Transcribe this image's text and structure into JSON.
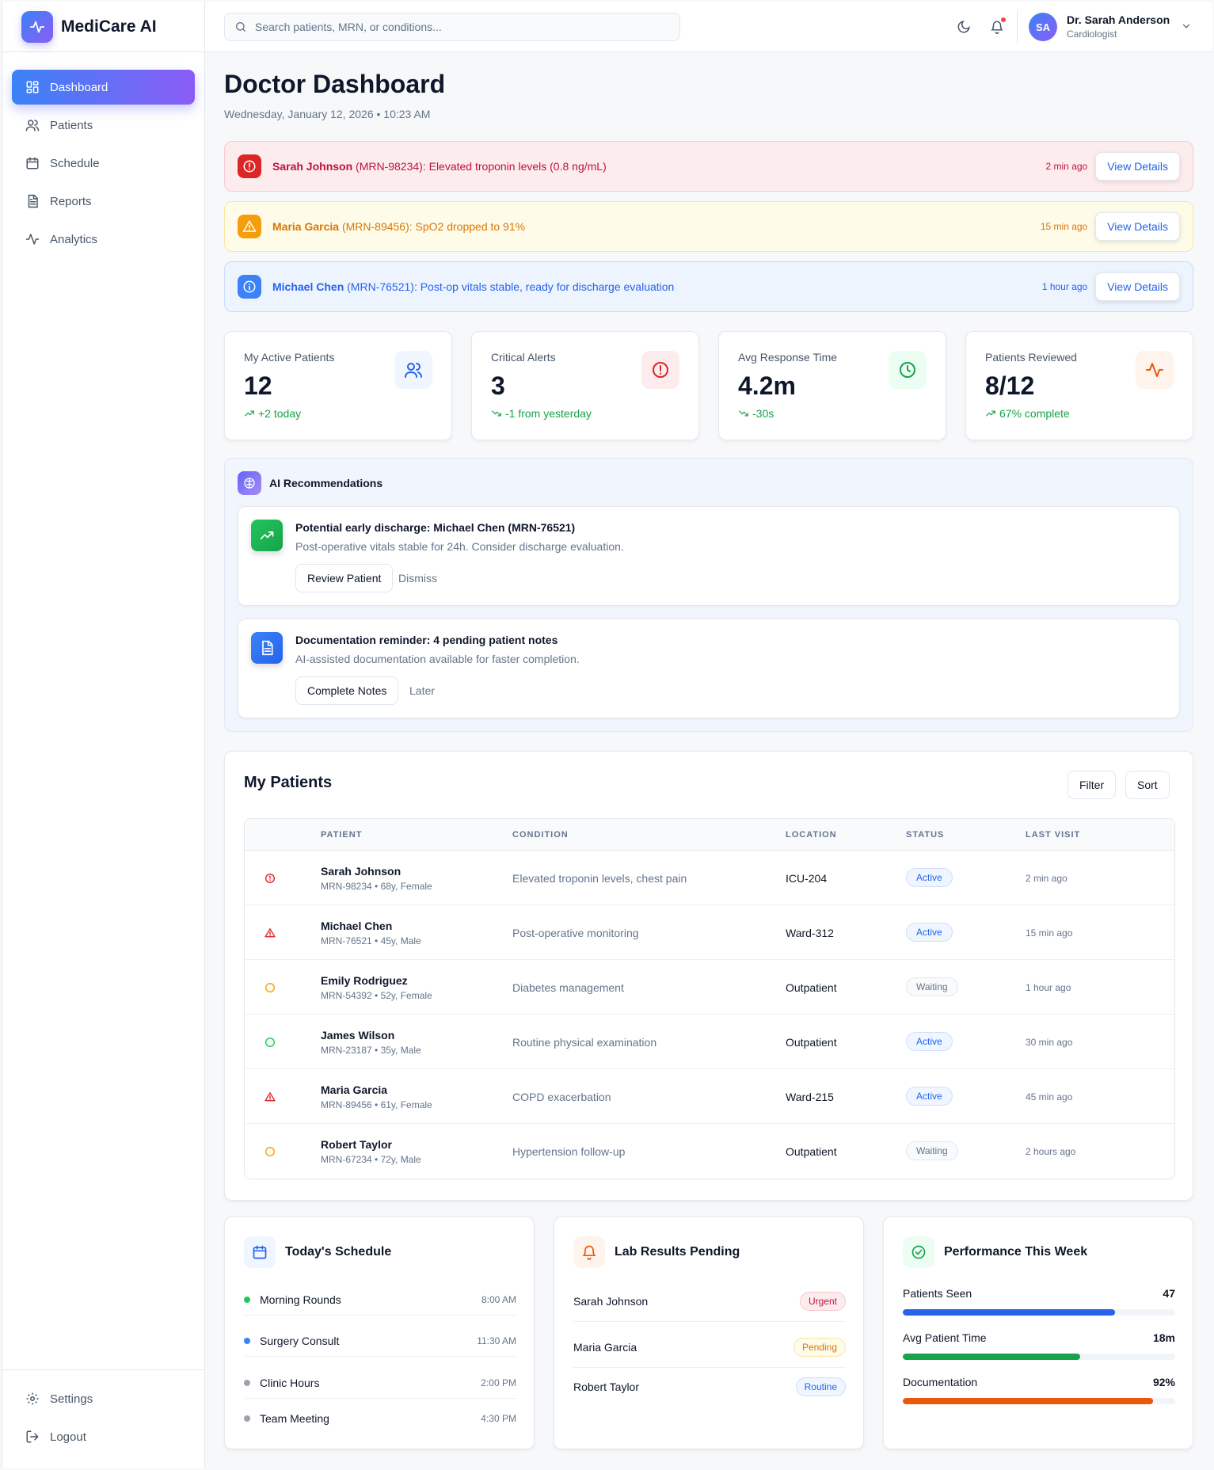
{
  "brand": {
    "name": "MediCare AI"
  },
  "sidebar": {
    "items": [
      {
        "label": "Dashboard",
        "icon": "grid-icon"
      },
      {
        "label": "Patients",
        "icon": "users-icon"
      },
      {
        "label": "Schedule",
        "icon": "calendar-icon"
      },
      {
        "label": "Reports",
        "icon": "document-icon"
      },
      {
        "label": "Analytics",
        "icon": "activity-icon"
      }
    ],
    "bottom": [
      {
        "label": "Settings",
        "icon": "gear-icon"
      },
      {
        "label": "Logout",
        "icon": "logout-icon"
      }
    ]
  },
  "header": {
    "search_placeholder": "Search patients, MRN, or conditions...",
    "user": {
      "initials": "SA",
      "name": "Dr. Sarah Anderson",
      "role": "Cardiologist"
    }
  },
  "page": {
    "title": "Doctor Dashboard",
    "date": "Wednesday, January 12, 2026 • 10:23 AM"
  },
  "alerts": [
    {
      "name": "Sarah Johnson",
      "text": " (MRN-98234): Elevated troponin levels (0.8 ng/mL)",
      "time": "2 min ago",
      "action": "View Details",
      "level": "critical"
    },
    {
      "name": "Maria Garcia",
      "text": " (MRN-89456): SpO2 dropped to 91%",
      "time": "15 min ago",
      "action": "View Details",
      "level": "warning"
    },
    {
      "name": "Michael Chen",
      "text": " (MRN-76521): Post-op vitals stable, ready for discharge evaluation",
      "time": "1 hour ago",
      "action": "View Details",
      "level": "info"
    }
  ],
  "stats": [
    {
      "label": "My Active Patients",
      "value": "12",
      "trend": "+2 today"
    },
    {
      "label": "Critical Alerts",
      "value": "3",
      "trend": "-1 from yesterday"
    },
    {
      "label": "Avg Response Time",
      "value": "4.2m",
      "trend": "-30s"
    },
    {
      "label": "Patients Reviewed",
      "value": "8/12",
      "trend": "67% complete"
    }
  ],
  "ai": {
    "title": "AI Recommendations",
    "cards": [
      {
        "title": "Potential early discharge: Michael Chen (MRN-76521)",
        "desc": "Post-operative vitals stable for 24h. Consider discharge evaluation.",
        "primary": "Review Patient",
        "secondary": "Dismiss"
      },
      {
        "title": "Documentation reminder: 4 pending patient notes",
        "desc": "AI-assisted documentation available for faster completion.",
        "primary": "Complete Notes",
        "secondary": "Later"
      }
    ]
  },
  "patients": {
    "title": "My Patients",
    "filter_label": "Filter",
    "sort_label": "Sort",
    "columns": [
      "PATIENT",
      "CONDITION",
      "LOCATION",
      "STATUS",
      "LAST VISIT"
    ],
    "rows": [
      {
        "name": "Sarah Johnson",
        "meta": "MRN-98234 • 68y, Female",
        "condition": "Elevated troponin levels, chest pain",
        "location": "ICU-204",
        "status": "Active",
        "last_visit": "2 min ago",
        "priority": "critical"
      },
      {
        "name": "Michael Chen",
        "meta": "MRN-76521 • 45y, Male",
        "condition": "Post-operative monitoring",
        "location": "Ward-312",
        "status": "Active",
        "last_visit": "15 min ago",
        "priority": "high"
      },
      {
        "name": "Emily Rodriguez",
        "meta": "MRN-54392 • 52y, Female",
        "condition": "Diabetes management",
        "location": "Outpatient",
        "status": "Waiting",
        "last_visit": "1 hour ago",
        "priority": "medium"
      },
      {
        "name": "James Wilson",
        "meta": "MRN-23187 • 35y, Male",
        "condition": "Routine physical examination",
        "location": "Outpatient",
        "status": "Active",
        "last_visit": "30 min ago",
        "priority": "low"
      },
      {
        "name": "Maria Garcia",
        "meta": "MRN-89456 • 61y, Female",
        "condition": "COPD exacerbation",
        "location": "Ward-215",
        "status": "Active",
        "last_visit": "45 min ago",
        "priority": "high"
      },
      {
        "name": "Robert Taylor",
        "meta": "MRN-67234 • 72y, Male",
        "condition": "Hypertension follow-up",
        "location": "Outpatient",
        "status": "Waiting",
        "last_visit": "2 hours ago",
        "priority": "medium"
      }
    ]
  },
  "schedule": {
    "title": "Today's Schedule",
    "items": [
      {
        "name": "Morning Rounds",
        "time": "8:00 AM",
        "color": "#22c55e"
      },
      {
        "name": "Surgery Consult",
        "time": "11:30 AM",
        "color": "#3b82f6"
      },
      {
        "name": "Clinic Hours",
        "time": "2:00 PM",
        "color": "#9ca3af"
      },
      {
        "name": "Team Meeting",
        "time": "4:30 PM",
        "color": "#9ca3af"
      }
    ]
  },
  "labs": {
    "title": "Lab Results Pending",
    "items": [
      {
        "name": "Sarah Johnson",
        "badge": "Urgent"
      },
      {
        "name": "Maria Garcia",
        "badge": "Pending"
      },
      {
        "name": "Robert Taylor",
        "badge": "Routine"
      }
    ]
  },
  "performance": {
    "title": "Performance This Week",
    "items": [
      {
        "label": "Patients Seen",
        "value": "47",
        "fraction": 0.78,
        "color": "#2563eb"
      },
      {
        "label": "Avg Patient Time",
        "value": "18m",
        "fraction": 0.65,
        "color": "#16a34a"
      },
      {
        "label": "Documentation",
        "value": "92%",
        "fraction": 0.92,
        "color": "#ea580c"
      }
    ]
  }
}
